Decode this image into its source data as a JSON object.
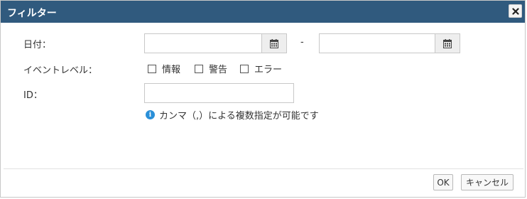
{
  "dialog": {
    "title": "フィルター"
  },
  "fields": {
    "date_label": "日付：",
    "date_from_value": "",
    "date_to_value": "",
    "date_separator": "-",
    "event_level_label": "イベントレベル：",
    "levels": [
      {
        "label": "情報",
        "checked": false
      },
      {
        "label": "警告",
        "checked": false
      },
      {
        "label": "エラー",
        "checked": false
      }
    ],
    "id_label": "ID：",
    "id_value": "",
    "id_hint": "カンマ（,）による複数指定が可能です"
  },
  "footer": {
    "ok_label": "OK",
    "cancel_label": "キャンセル"
  },
  "colors": {
    "titlebar": "#305a7e",
    "info_icon": "#2a8fd8"
  },
  "icons": {
    "close": "close-icon",
    "calendar": "calendar-icon",
    "info": "info-icon"
  }
}
